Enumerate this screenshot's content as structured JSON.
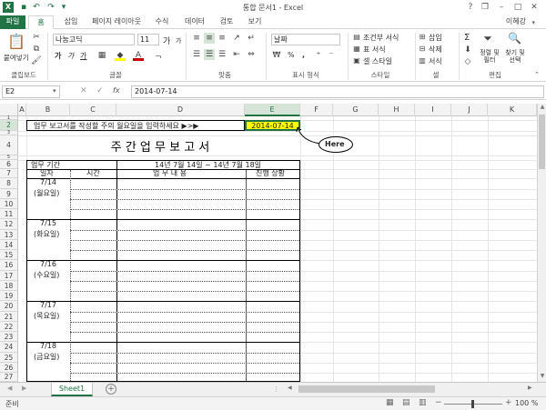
{
  "window": {
    "title": "통합 문서1 - Excel",
    "min": "–",
    "max": "□",
    "close": "✕",
    "help": "?",
    "restore": "❐"
  },
  "tabs": [
    "파일",
    "홈",
    "삽입",
    "페이지 레이아웃",
    "수식",
    "데이터",
    "검토",
    "보기"
  ],
  "user": "이혜강",
  "ribbon": {
    "clipboard": {
      "paste": "붙여넣기",
      "label": "클립보드"
    },
    "font": {
      "name": "나눔고딕",
      "size": "11",
      "bold": "가",
      "italic": "가",
      "underline": "가",
      "grow": "가",
      "shrink": "가",
      "label": "글꼴"
    },
    "align": {
      "label": "맞춤"
    },
    "number": {
      "format": "날짜",
      "percent": "%",
      "comma": ",",
      "label": "표시 형식"
    },
    "styles": {
      "cond": "조건부 서식",
      "table": "표 서식",
      "cell": "셀 스타일",
      "label": "스타일"
    },
    "cells": {
      "insert": "삽입",
      "delete": "삭제",
      "format": "서식",
      "label": "셀"
    },
    "editing": {
      "sum": "Σ",
      "sort": "정렬 및 필터",
      "find": "찾기 및 선택",
      "label": "편집"
    }
  },
  "formula": {
    "namebox": "E2",
    "value": "2014-07-14",
    "fx": "fx"
  },
  "columns": [
    "A",
    "B",
    "C",
    "D",
    "E",
    "F",
    "G",
    "H",
    "I",
    "J",
    "K"
  ],
  "rows": [
    "1",
    "2",
    "3",
    "4",
    "5",
    "6",
    "7",
    "8",
    "9",
    "10",
    "11",
    "12",
    "13",
    "14",
    "15",
    "16",
    "17",
    "18",
    "19",
    "20",
    "21",
    "22",
    "23",
    "24",
    "25",
    "26",
    "27"
  ],
  "sheet": {
    "instruction": "업무 보고서를 작성할 주의 월요일을 입력하세요  ▶>▶",
    "input_date": "2014-07-14",
    "callout": "Here",
    "title": "주 간 업 무 보 고 서",
    "period_label": "업무 기간",
    "period_value": "14년 7월 14일 ~ 14년 7월 18일",
    "headers": {
      "date": "일자",
      "time": "시간",
      "content": "업  무  내  용",
      "status": "진행 상황"
    },
    "days": [
      {
        "date": "7/14",
        "weekday": "(월요일)"
      },
      {
        "date": "7/15",
        "weekday": "(화요일)"
      },
      {
        "date": "7/16",
        "weekday": "(수요일)"
      },
      {
        "date": "7/17",
        "weekday": "(목요일)"
      },
      {
        "date": "7/18",
        "weekday": "(금요일)"
      }
    ]
  },
  "sheets": [
    "Sheet1"
  ],
  "status": {
    "ready": "준비",
    "zoom": "100 %",
    "minus": "−",
    "plus": "+"
  },
  "colors": {
    "accent": "#217346",
    "highlight": "#ffff00"
  }
}
